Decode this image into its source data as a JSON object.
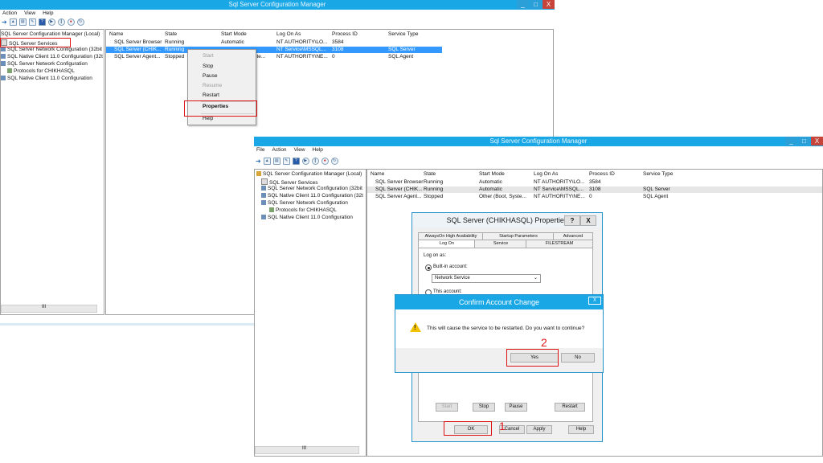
{
  "back": {
    "title": "Sql Server Configuration Manager",
    "window_controls": [
      "_",
      "□",
      "X"
    ],
    "menu": [
      "Action",
      "View",
      "Help"
    ],
    "tree": [
      "SQL Server Configuration Manager (Local)",
      "SQL Server Services",
      "SQL Server Network Configuration (32bit",
      "SQL Native Client 11.0 Configuration (32t",
      "SQL Server Network Configuration",
      "Protocols for CHIKHASQL",
      "SQL Native Client 11.0 Configuration"
    ],
    "columns": [
      "Name",
      "State",
      "Start Mode",
      "Log On As",
      "Process ID",
      "Service Type"
    ],
    "rows": [
      [
        "SQL Server Browser",
        "Running",
        "Automatic",
        "NT AUTHORITY\\LO...",
        "3584",
        ""
      ],
      [
        "SQL Server (CHIK...",
        "Running",
        "",
        "NT Service\\MSSQL...",
        "3108",
        "SQL Server"
      ],
      [
        "SQL Server Agent...",
        "Stopped",
        "yste...",
        "NT AUTHORITY\\NE...",
        "0",
        "SQL Agent"
      ]
    ],
    "context_menu": [
      "Start",
      "Stop",
      "Pause",
      "Resume",
      "Restart",
      "Properties",
      "Help"
    ],
    "scroll_label": "III"
  },
  "front": {
    "title": "Sql Server Configuration Manager",
    "window_controls": [
      "_",
      "□",
      "X"
    ],
    "menu": [
      "File",
      "Action",
      "View",
      "Help"
    ],
    "tree": [
      "SQL Server Configuration Manager (Local)",
      "SQL Server Services",
      "SQL Server Network Configuration (32bit",
      "SQL Native Client 11.0 Configuration (32t",
      "SQL Server Network Configuration",
      "Protocols for CHIKHASQL",
      "SQL Native Client 11.0 Configuration"
    ],
    "columns": [
      "Name",
      "State",
      "Start Mode",
      "Log On As",
      "Process ID",
      "Service Type"
    ],
    "rows": [
      [
        "SQL Server Browser",
        "Running",
        "Automatic",
        "NT AUTHORITY\\LO...",
        "3584",
        ""
      ],
      [
        "SQL Server (CHIK...",
        "Running",
        "Automatic",
        "NT Service\\MSSQL...",
        "3108",
        "SQL Server"
      ],
      [
        "SQL Server Agent...",
        "Stopped",
        "Other (Boot, Syste...",
        "NT AUTHORITY\\NE...",
        "0",
        "SQL Agent"
      ]
    ],
    "scroll_label": "III"
  },
  "properties": {
    "title": "SQL Server (CHIKHASQL) Properties",
    "help": "?",
    "close": "X",
    "tabs_row1": [
      "AlwaysOn High Availability",
      "Startup Parameters",
      "Advanced"
    ],
    "tabs_row2": [
      "Log On",
      "Service",
      "FILESTREAM"
    ],
    "log_on_as": "Log on as:",
    "builtin": "Built-in account:",
    "builtin_value": "Network Service",
    "this_account": "This account:",
    "service_buttons": [
      "Start",
      "Stop",
      "Pause",
      "Restart"
    ],
    "bottom_buttons": [
      "OK",
      "Cancel",
      "Apply",
      "Help"
    ]
  },
  "confirm": {
    "title": "Confirm Account Change",
    "close": "X",
    "message": "This will cause the service to be restarted. Do you want to continue?",
    "yes": "Yes",
    "no": "No"
  },
  "steps": [
    "1",
    "2"
  ]
}
